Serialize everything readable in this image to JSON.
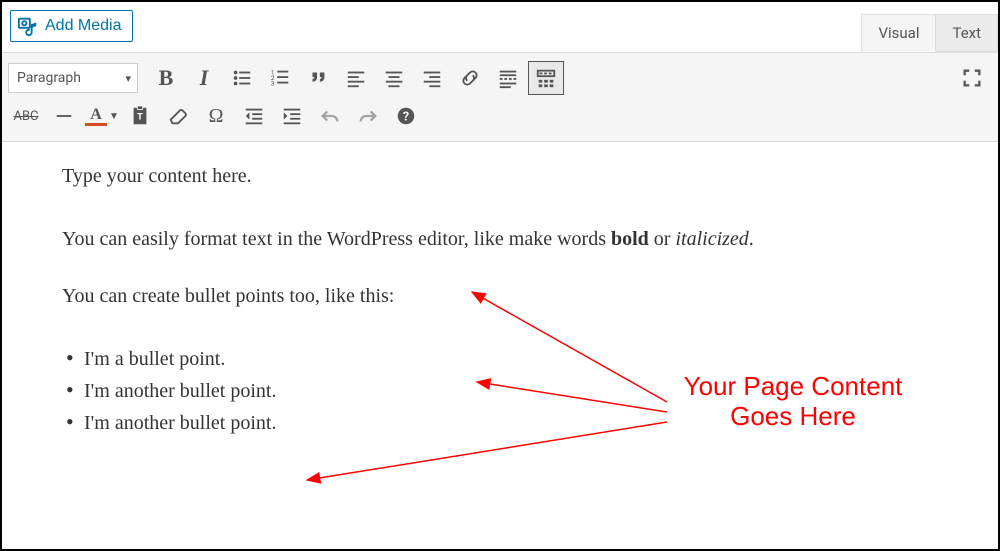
{
  "media": {
    "add_label": "Add Media"
  },
  "tabs": {
    "visual": "Visual",
    "text": "Text"
  },
  "format": {
    "selected": "Paragraph"
  },
  "content": {
    "p1": "Type your content here.",
    "p2_a": "You can easily format text in the WordPress editor, like make words ",
    "p2_bold": "bold",
    "p2_b": " or ",
    "p2_italic": "italicized",
    "p2_c": ".",
    "p3": "You can create bullet points too, like this:",
    "li1": "I'm a bullet point.",
    "li2": "I'm another bullet point.",
    "li3": "I'm another bullet point."
  },
  "annotation": {
    "line1": "Your Page Content",
    "line2": "Goes Here"
  },
  "colors": {
    "link": "#0073aa",
    "annotation": "#ff0000"
  }
}
